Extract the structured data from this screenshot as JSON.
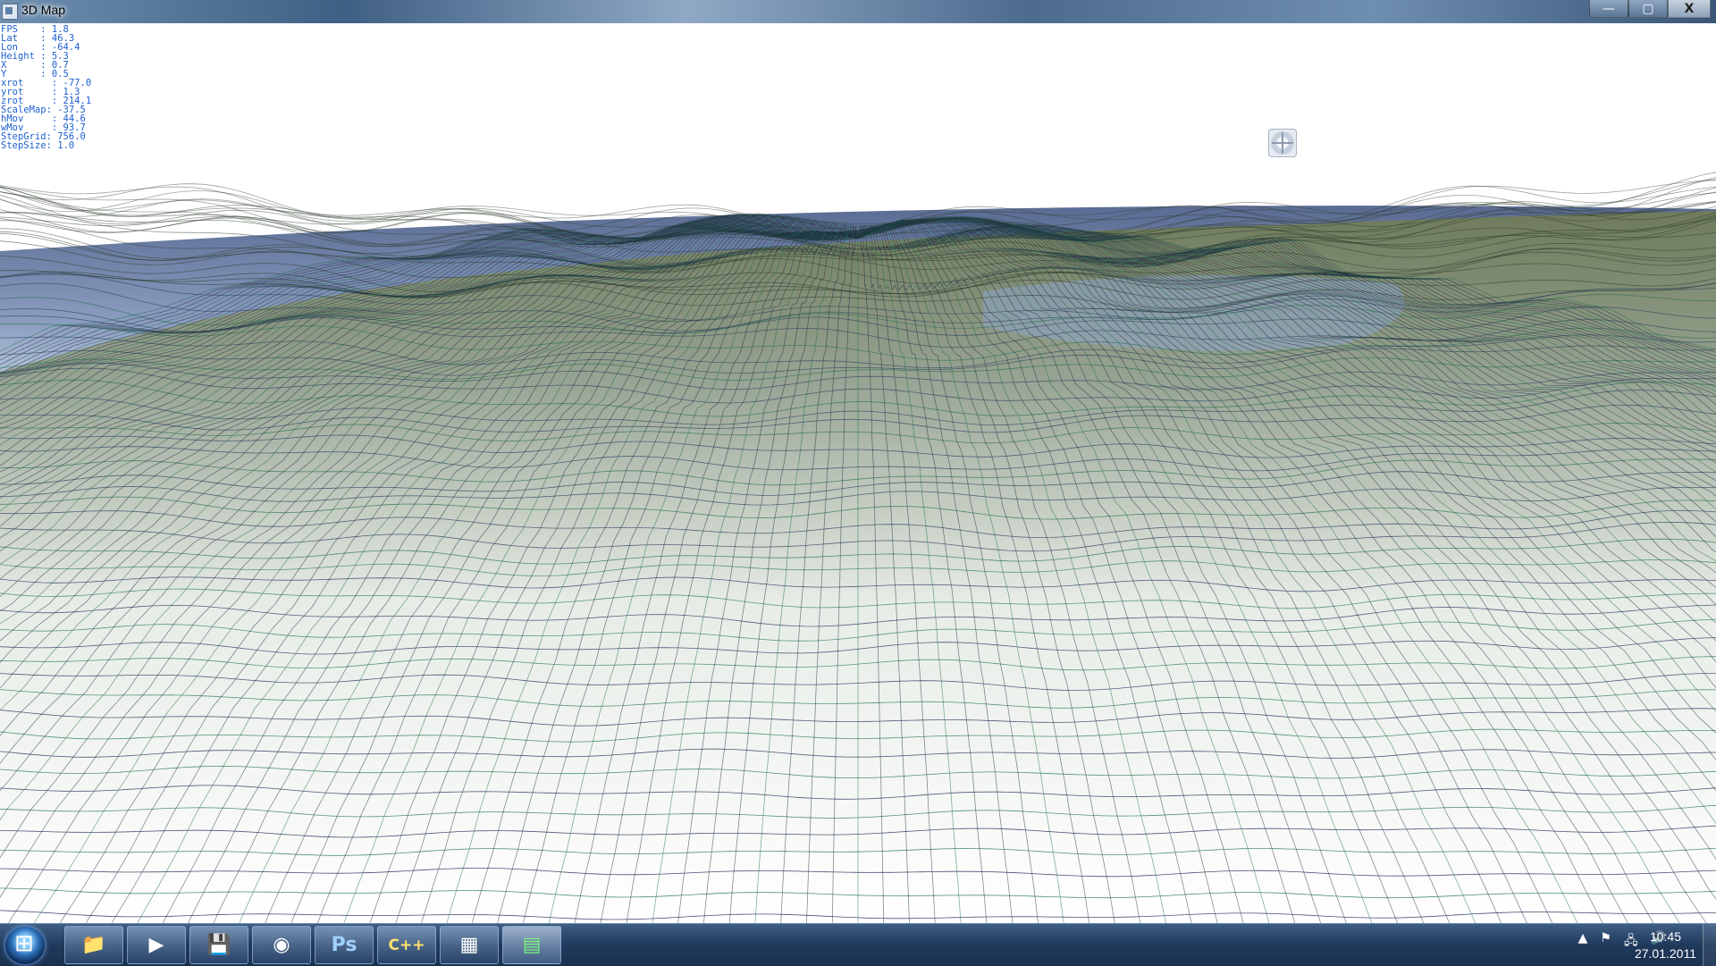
{
  "window": {
    "title": "3D Map",
    "controls": {
      "minimize": "—",
      "maximize": "▢",
      "close": "X"
    }
  },
  "hud": {
    "lines": [
      "FPS    : 1.8",
      "Lat    : 46.3",
      "Lon    : -64.4",
      "Height : 5.3",
      "X      : 0.7",
      "Y      : 0.5",
      "xrot     : -77.0",
      "yrot     : 1.3",
      "zrot     : 214.1",
      "ScaleMap: -37.5",
      "hMov     : 44.6",
      "wMov     : 93.7",
      "StepGrid: 756.0",
      "StepSize: 1.0"
    ]
  },
  "taskbar": {
    "apps": [
      {
        "name": "explorer",
        "icon": "folder-icon",
        "glyph": "📁"
      },
      {
        "name": "media-player",
        "icon": "media-player-icon",
        "glyph": "▶"
      },
      {
        "name": "save",
        "icon": "floppy-disk-icon",
        "glyph": "💾"
      },
      {
        "name": "chrome",
        "icon": "chrome-icon",
        "glyph": "◉"
      },
      {
        "name": "photoshop",
        "icon": "photoshop-icon",
        "glyph": "Ps"
      },
      {
        "name": "cpp-builder",
        "icon": "cpp-builder-icon",
        "glyph": "C++"
      },
      {
        "name": "app-grid",
        "icon": "app-grid-icon",
        "glyph": "▦"
      },
      {
        "name": "3d-map",
        "icon": "map-app-icon",
        "glyph": "▤"
      }
    ],
    "tray": {
      "arrow": "▲",
      "flag": "⚑",
      "network": "🖧",
      "volume": "🔊"
    },
    "clock": {
      "time": "10:45",
      "date": "27.01.2011"
    }
  }
}
